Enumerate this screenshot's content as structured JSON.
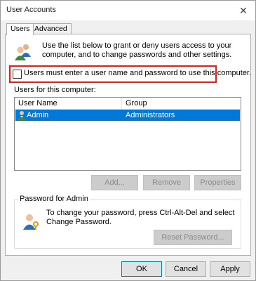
{
  "window": {
    "title": "User Accounts",
    "close_glyph": "✕"
  },
  "tabs": [
    {
      "label": "Users",
      "active": true
    },
    {
      "label": "Advanced",
      "active": false
    }
  ],
  "intro": {
    "icon": "users-icon",
    "text": "Use the list below to grant or deny users access to your computer, and to change passwords and other settings."
  },
  "require_login": {
    "label": "Users must enter a user name and password to use this computer.",
    "checked": false
  },
  "users_section": {
    "label": "Users for this computer:"
  },
  "user_list": {
    "columns": [
      "User Name",
      "Group"
    ],
    "rows": [
      {
        "user": "Admin",
        "group": "Administrators",
        "selected": true
      }
    ]
  },
  "user_buttons": {
    "add": "Add...",
    "remove": "Remove",
    "properties": "Properties"
  },
  "password_group": {
    "legend": "Password for Admin",
    "icon": "user-key-icon",
    "text": "To change your password, press Ctrl-Alt-Del and select Change Password.",
    "reset_button": "Reset Password..."
  },
  "dialog_buttons": {
    "ok": "OK",
    "cancel": "Cancel",
    "apply": "Apply"
  },
  "colors": {
    "selection": "#0078d7",
    "highlight_border": "#e0201c"
  }
}
